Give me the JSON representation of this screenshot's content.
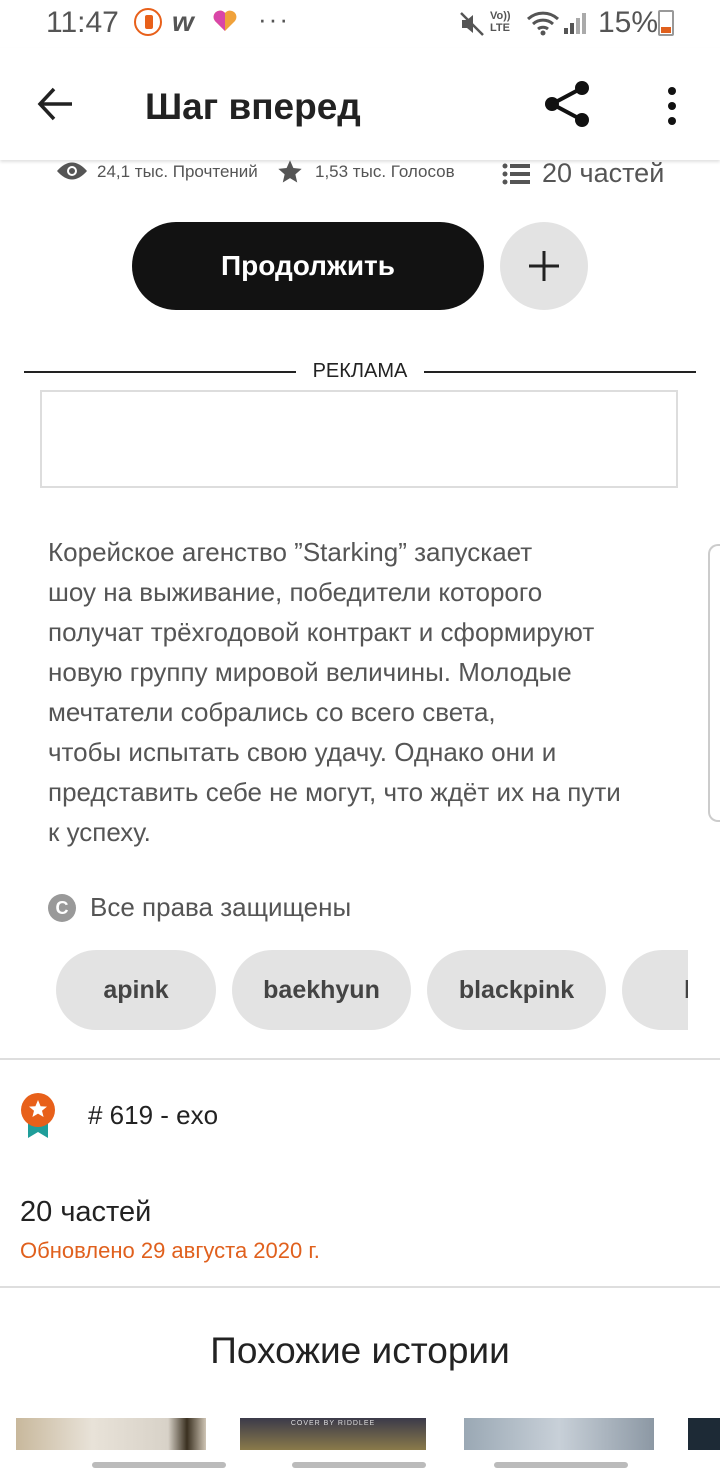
{
  "status_bar": {
    "time": "11:47",
    "battery": "15%",
    "more_dots": "···",
    "network": "Vo)) LTE"
  },
  "app_bar": {
    "title": "Шаг вперед"
  },
  "stats": {
    "reads": "24,1 тыс. Прочтений",
    "votes": "1,53 тыс. Голосов",
    "parts": "20 частей"
  },
  "buttons": {
    "continue_label": "Продолжить"
  },
  "ad": {
    "label": "РЕКЛАМА"
  },
  "description": "Корейское агенство ”Starking” запускает\nшоу на выживание, победители которого\nполучат трёхгодовой контракт и сформируют\nновую группу мировой величины. Молодые\nмечтатели собрались со всего света,\nчтобы испытать свою удачу. Однако они и\nпредставить себе не могут, что ждёт их на пути\nк успеху.",
  "copyright": {
    "symbol": "C",
    "label": "Все права защищены"
  },
  "tags": [
    "apink",
    "baekhyun",
    "blackpink",
    "b"
  ],
  "ranking": {
    "text": "# 619 - exo"
  },
  "parts_info": {
    "count": "20 частей",
    "updated": "Обновлено 29 августа 2020 г."
  },
  "similar": {
    "title": "Похожие истории",
    "cover_caption": "COVER BY RIDDLEE"
  },
  "colors": {
    "accent_orange": "#e0601d",
    "button_dark": "#121212",
    "chip_gray": "#e3e3e3",
    "badge_orange": "#e8601a",
    "badge_teal": "#1f9e9a"
  }
}
